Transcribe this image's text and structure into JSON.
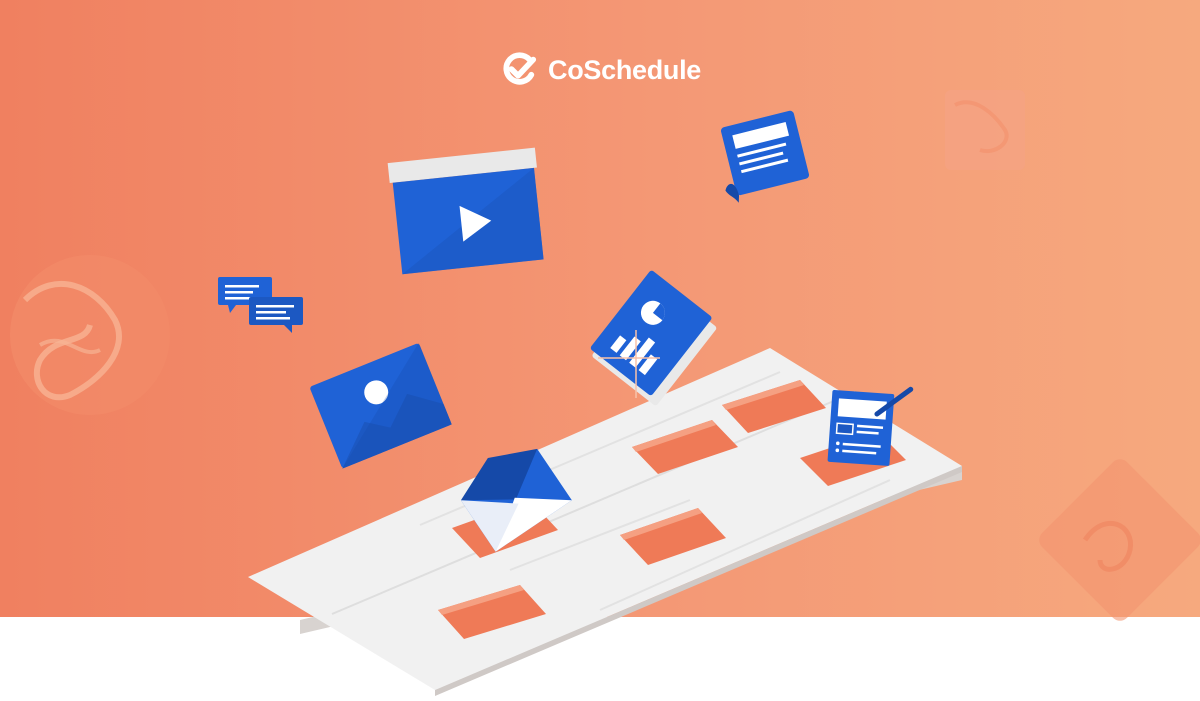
{
  "brand": {
    "name": "CoSchedule",
    "logo_icon": "coschedule-check-icon"
  },
  "colors": {
    "background_start": "#f08060",
    "background_end": "#f6a97e",
    "icon_blue": "#1f62d6",
    "icon_blue_dark": "#1549a8",
    "calendar_surface": "#f1f1f1",
    "calendar_slot": "#ef7a57",
    "page_bottom": "#ffffff"
  },
  "illustration": {
    "floating_icons": [
      "video-play-icon",
      "document-scroll-icon",
      "chat-bubbles-icon",
      "report-chart-icon",
      "image-photo-icon",
      "email-envelope-icon",
      "blog-post-edit-icon"
    ],
    "calendar": "content-calendar-grid",
    "decorations": [
      "marble-circle-texture",
      "marble-square-texture",
      "marble-diamond-texture"
    ]
  }
}
